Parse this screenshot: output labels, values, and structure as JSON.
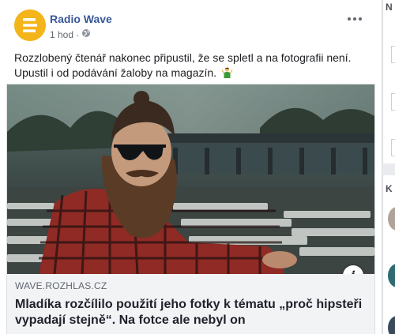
{
  "post": {
    "page_name": "Radio Wave",
    "time": "1 hod",
    "separator": "·",
    "text": "Rozzlobený čtenář nakonec připustil, že se spletl a na fotografii není. Upustil i od podávání žaloby na magazín.",
    "emoji_icon": "man-gesturing-ok-emoji",
    "privacy_icon": "globe-icon",
    "more_icon": "more-dots-icon",
    "brand_color": "#f3b51a",
    "name_color": "#385898"
  },
  "link_preview": {
    "domain": "WAVE.ROZHLAS.CZ",
    "headline": "Mladíka rozčílilo použití jeho fotky k tématu „proč hipsteři vypadají stejně“. Na fotce ale nebyl on",
    "info_label": "i"
  },
  "sidebar": {
    "top_letter": "N",
    "bottom_letter": "K"
  }
}
